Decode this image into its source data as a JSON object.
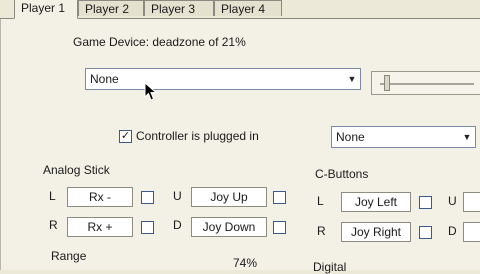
{
  "tabs": [
    {
      "label": "Player 1"
    },
    {
      "label": "Player 2"
    },
    {
      "label": "Player 3"
    },
    {
      "label": "Player 4"
    }
  ],
  "device": {
    "label": "Game Device: deadzone of 21%",
    "selected": "None"
  },
  "plugged": {
    "label": "Controller is plugged in",
    "checked": true,
    "plugin_selected": "None"
  },
  "analog": {
    "title": "Analog Stick",
    "rows": [
      {
        "dir": "L",
        "value": "Rx -",
        "dir2": "U",
        "value2": "Joy Up"
      },
      {
        "dir": "R",
        "value": "Rx +",
        "dir2": "D",
        "value2": "Joy Down"
      }
    ],
    "range_label": "Range",
    "range_value": "74%"
  },
  "cbuttons": {
    "title": "C-Buttons",
    "rows": [
      {
        "dir": "L",
        "value": "Joy Left",
        "dir2": "U"
      },
      {
        "dir": "R",
        "value": "Joy Right",
        "dir2": "D"
      }
    ]
  },
  "dpad": {
    "title": "Digital"
  }
}
